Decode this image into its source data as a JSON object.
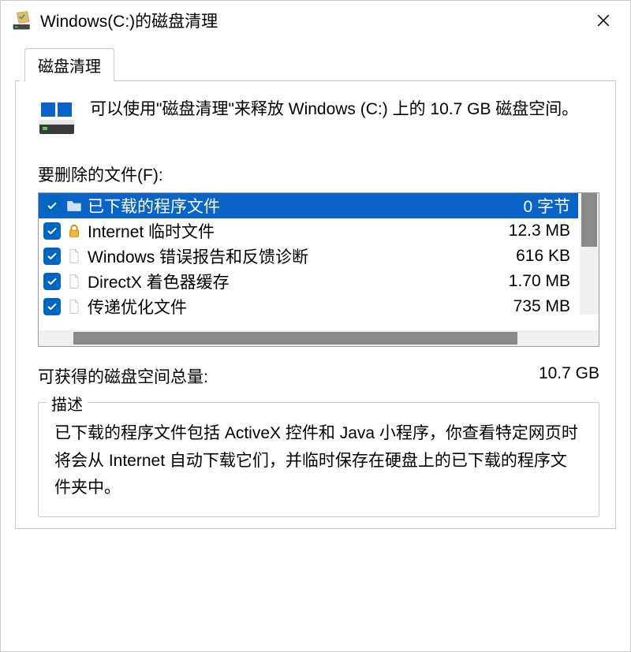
{
  "title": "Windows(C:)的磁盘清理",
  "tab_label": "磁盘清理",
  "intro_text": "可以使用\"磁盘清理\"来释放 Windows (C:) 上的 10.7 GB 磁盘空间。",
  "files_to_delete_label": "要删除的文件(F):",
  "list": {
    "items": [
      {
        "name": "已下载的程序文件",
        "size": "0 字节",
        "icon": "folder",
        "selected": true
      },
      {
        "name": "Internet 临时文件",
        "size": "12.3 MB",
        "icon": "lock",
        "selected": false
      },
      {
        "name": "Windows 错误报告和反馈诊断",
        "size": "616 KB",
        "icon": "file",
        "selected": false
      },
      {
        "name": "DirectX 着色器缓存",
        "size": "1.70 MB",
        "icon": "file",
        "selected": false
      },
      {
        "name": "传递优化文件",
        "size": "735 MB",
        "icon": "file",
        "selected": false
      }
    ]
  },
  "total_label": "可获得的磁盘空间总量:",
  "total_value": "10.7 GB",
  "description_title": "描述",
  "description_text": "已下载的程序文件包括 ActiveX 控件和 Java 小程序，你查看特定网页时将会从 Internet 自动下载它们，并临时保存在硬盘上的已下载的程序文件夹中。"
}
